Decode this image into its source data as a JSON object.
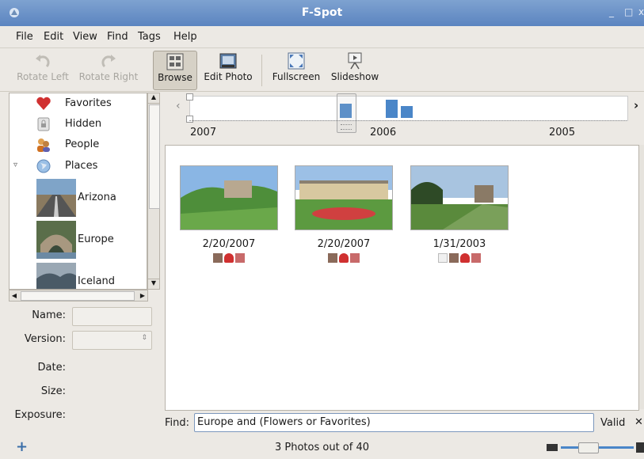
{
  "window": {
    "title": "F-Spot",
    "minimize": "_",
    "maximize": "□",
    "close": "x"
  },
  "menu": [
    "File",
    "Edit",
    "View",
    "Find",
    "Tags",
    "Help"
  ],
  "toolbar": {
    "rotate_left": "Rotate Left",
    "rotate_right": "Rotate Right",
    "browse": "Browse",
    "edit_photo": "Edit Photo",
    "fullscreen": "Fullscreen",
    "slideshow": "Slideshow"
  },
  "tags": {
    "favorites": "Favorites",
    "hidden": "Hidden",
    "people": "People",
    "places": "Places",
    "places_children": [
      "Arizona",
      "Europe",
      "Iceland"
    ]
  },
  "info": {
    "name_label": "Name:",
    "version_label": "Version:",
    "date_label": "Date:",
    "size_label": "Size:",
    "exposure_label": "Exposure:"
  },
  "timeline": {
    "years": [
      "2007",
      "2006",
      "2005"
    ],
    "scroll_left": "‹",
    "scroll_right": "›"
  },
  "photos": [
    {
      "date": "2/20/2007",
      "tags": [
        "people",
        "favorites",
        "flowers"
      ]
    },
    {
      "date": "2/20/2007",
      "tags": [
        "people",
        "favorites",
        "flowers"
      ]
    },
    {
      "date": "1/31/2003",
      "tags": [
        "blank",
        "people",
        "favorites",
        "flowers"
      ]
    }
  ],
  "find": {
    "label": "Find:",
    "query": "Europe and (Flowers or Favorites)",
    "status": "Valid",
    "clear": "✕"
  },
  "status": {
    "text": "3 Photos out of 40",
    "add": "+"
  },
  "colors": {
    "titlebar": "#5b84c0",
    "selection_blue": "#4a86c8",
    "heart": "#d03030"
  }
}
